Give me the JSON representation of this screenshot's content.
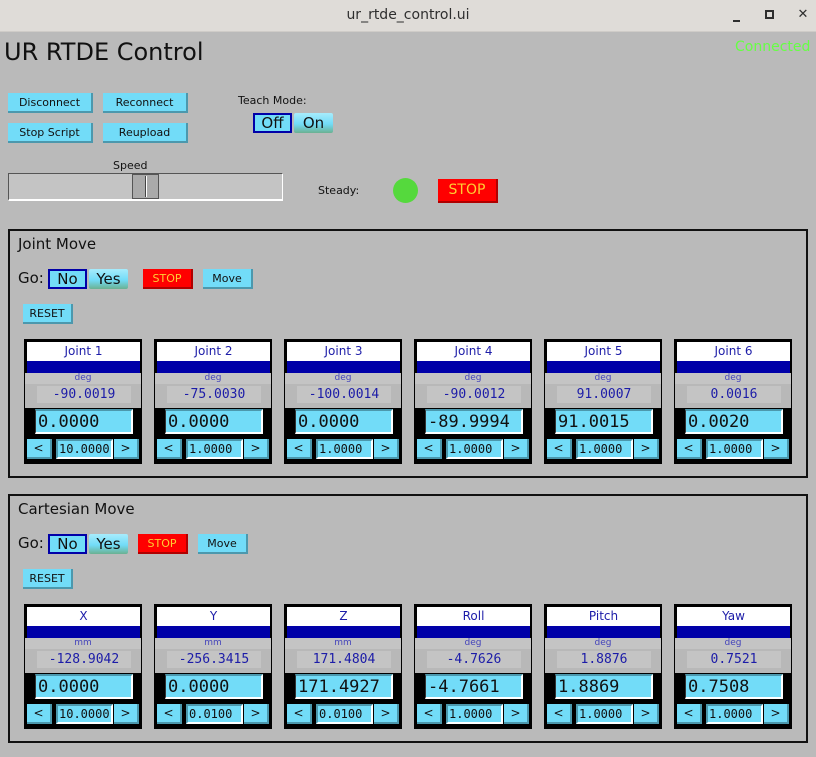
{
  "window": {
    "title": "ur_rtde_control.ui",
    "controls": [
      "minimize",
      "maximize",
      "close"
    ]
  },
  "app": {
    "title": "UR RTDE Control",
    "status": "Connected",
    "status_color": "#66ff44"
  },
  "toolbar": {
    "disconnect_label": "Disconnect",
    "reconnect_label": "Reconnect",
    "stop_script_label": "Stop Script",
    "reupload_label": "Reupload"
  },
  "teach_mode": {
    "label": "Teach Mode:",
    "off_label": "Off",
    "on_label": "On",
    "selected": "Off"
  },
  "speed": {
    "label": "Speed",
    "value_fraction": 0.5
  },
  "steady": {
    "label": "Steady:",
    "indicator_color": "#55d93d",
    "stop_label": "STOP"
  },
  "joint_move": {
    "title": "Joint Move",
    "go_label": "Go:",
    "no_label": "No",
    "yes_label": "Yes",
    "selected": "No",
    "stop_label": "STOP",
    "move_label": "Move",
    "reset_label": "RESET",
    "axes": [
      {
        "name": "Joint 1",
        "unit": "deg",
        "actual": "-90.0019",
        "target": "0.0000",
        "step": "10.0000"
      },
      {
        "name": "Joint 2",
        "unit": "deg",
        "actual": "-75.0030",
        "target": "0.0000",
        "step": "1.0000"
      },
      {
        "name": "Joint 3",
        "unit": "deg",
        "actual": "-100.0014",
        "target": "0.0000",
        "step": "1.0000"
      },
      {
        "name": "Joint 4",
        "unit": "deg",
        "actual": "-90.0012",
        "target": "-89.9994",
        "step": "1.0000"
      },
      {
        "name": "Joint 5",
        "unit": "deg",
        "actual": "91.0007",
        "target": "91.0015",
        "step": "1.0000"
      },
      {
        "name": "Joint 6",
        "unit": "deg",
        "actual": "0.0016",
        "target": "0.0020",
        "step": "1.0000"
      }
    ]
  },
  "cartesian_move": {
    "title": "Cartesian Move",
    "go_label": "Go:",
    "no_label": "No",
    "yes_label": "Yes",
    "selected": "No",
    "stop_label": "STOP",
    "move_label": "Move",
    "reset_label": "RESET",
    "axes": [
      {
        "name": "X",
        "unit": "mm",
        "actual": "-128.9042",
        "target": "0.0000",
        "step": "10.0000"
      },
      {
        "name": "Y",
        "unit": "mm",
        "actual": "-256.3415",
        "target": "0.0000",
        "step": "0.0100"
      },
      {
        "name": "Z",
        "unit": "mm",
        "actual": "171.4804",
        "target": "171.4927",
        "step": "0.0100"
      },
      {
        "name": "Roll",
        "unit": "deg",
        "actual": "-4.7626",
        "target": "-4.7661",
        "step": "1.0000"
      },
      {
        "name": "Pitch",
        "unit": "deg",
        "actual": "1.8876",
        "target": "1.8869",
        "step": "1.0000"
      },
      {
        "name": "Yaw",
        "unit": "deg",
        "actual": "0.7521",
        "target": "0.7508",
        "step": "1.0000"
      }
    ]
  },
  "stepper": {
    "dec_label": "<",
    "inc_label": ">"
  }
}
